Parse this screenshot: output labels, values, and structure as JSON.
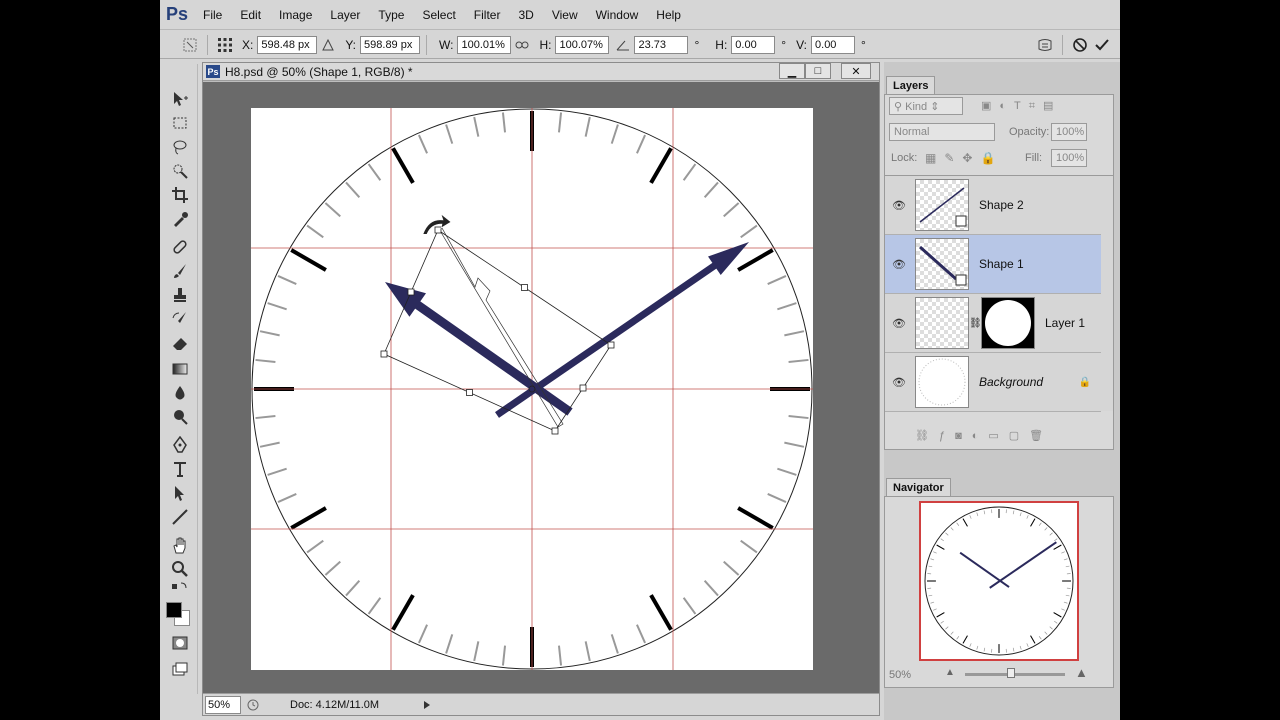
{
  "app": {
    "logo": "Ps",
    "menu": [
      "File",
      "Edit",
      "Image",
      "Layer",
      "Type",
      "Select",
      "Filter",
      "3D",
      "View",
      "Window",
      "Help"
    ]
  },
  "options_bar": {
    "x_label": "X:",
    "x_value": "598.48 px",
    "y_label": "Y:",
    "y_value": "598.89 px",
    "w_label": "W:",
    "w_value": "100.01%",
    "h_label": "H:",
    "h_value": "100.07%",
    "angle_value": "23.73",
    "degree_symbol": "°",
    "hskew_label": "H:",
    "hskew_value": "0.00",
    "vskew_label": "V:",
    "vskew_value": "0.00"
  },
  "document": {
    "title": "H8.psd @ 50% (Shape 1, RGB/8) *",
    "ps_badge": "Ps",
    "zoom": "50%",
    "doc_info": "Doc: 4.12M/11.0M"
  },
  "layers_panel": {
    "tab": "Layers",
    "kind_label": "Kind",
    "blend_mode": "Normal",
    "opacity_label": "Opacity:",
    "opacity_value": "100%",
    "lock_label": "Lock:",
    "fill_label": "Fill:",
    "fill_value": "100%",
    "layers": [
      {
        "name": "Shape 2",
        "selected": false
      },
      {
        "name": "Shape 1",
        "selected": true
      },
      {
        "name": "Layer 1",
        "selected": false
      },
      {
        "name": "Background",
        "selected": false
      }
    ]
  },
  "navigator_panel": {
    "tab": "Navigator",
    "zoom": "50%"
  },
  "colors": {
    "hand_color": "#2b2a5c",
    "guide_color": "#c0504d",
    "selected_layer": "#b7c6e6",
    "canvas_bg": "#6a6a6a"
  }
}
